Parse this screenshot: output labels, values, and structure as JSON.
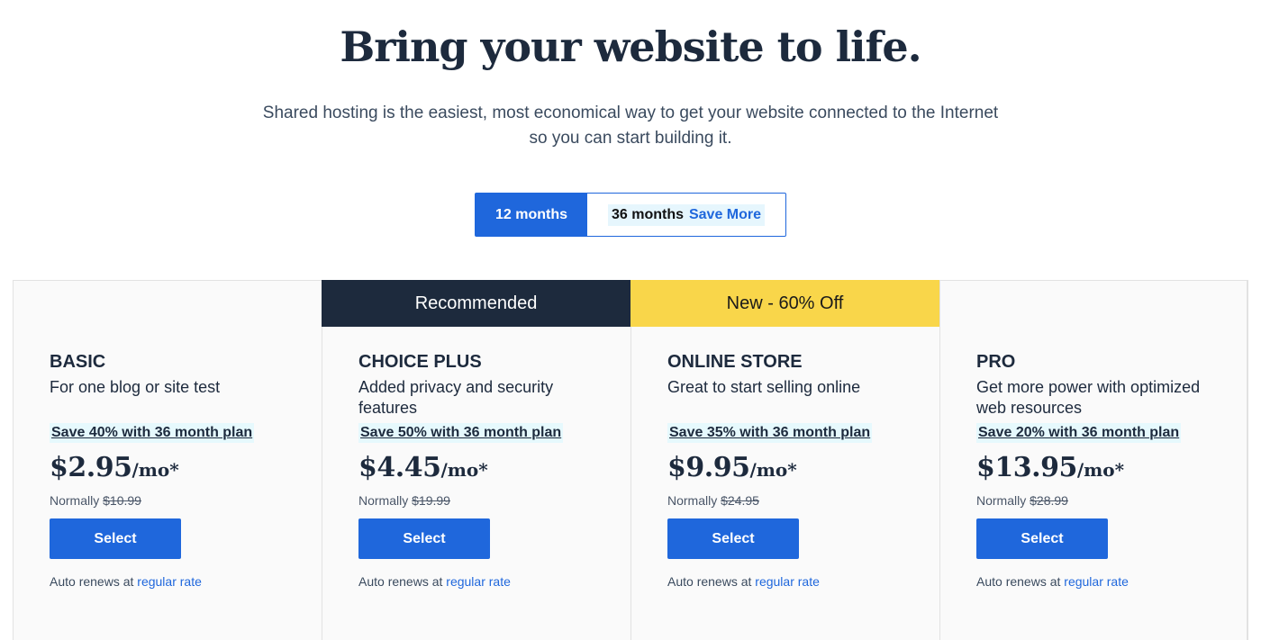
{
  "hero": {
    "title": "Bring your website to life.",
    "subtitle": "Shared hosting is the easiest, most economical way to get your website connected to the Internet so you can start building it."
  },
  "term_toggle": {
    "option_12": "12 months",
    "option_36": "36 months",
    "option_36_badge": "Save More",
    "selected": "12 months"
  },
  "colors": {
    "primary_blue": "#1f67dc",
    "navy": "#1d2a3d",
    "yellow": "#f9d64a",
    "savings_bg": "#e6f9fd"
  },
  "plans": [
    {
      "banner": "",
      "name": "BASIC",
      "description": "For one blog or site test",
      "savings": "Save 40% with 36 month plan",
      "price": "$2.95",
      "per": "/mo*",
      "normally_label": "Normally",
      "normal_price": "$10.99",
      "select_label": "Select",
      "renew_text": "Auto renews at",
      "renew_link": "regular rate"
    },
    {
      "banner": "Recommended",
      "name": "CHOICE PLUS",
      "description": "Added privacy and security features",
      "savings": "Save 50% with 36 month plan",
      "price": "$4.45",
      "per": "/mo*",
      "normally_label": "Normally",
      "normal_price": "$19.99",
      "select_label": "Select",
      "renew_text": "Auto renews at",
      "renew_link": "regular rate"
    },
    {
      "banner": "New - 60% Off",
      "name": "ONLINE STORE",
      "description": "Great to start selling online",
      "savings": "Save 35% with 36 month plan",
      "price": "$9.95",
      "per": "/mo*",
      "normally_label": "Normally",
      "normal_price": "$24.95",
      "select_label": "Select",
      "renew_text": "Auto renews at",
      "renew_link": "regular rate"
    },
    {
      "banner": "",
      "name": "PRO",
      "description": "Get more power with optimized web resources",
      "savings": "Save 20% with 36 month plan",
      "price": "$13.95",
      "per": "/mo*",
      "normally_label": "Normally",
      "normal_price": "$28.99",
      "select_label": "Select",
      "renew_text": "Auto renews at",
      "renew_link": "regular rate"
    }
  ]
}
